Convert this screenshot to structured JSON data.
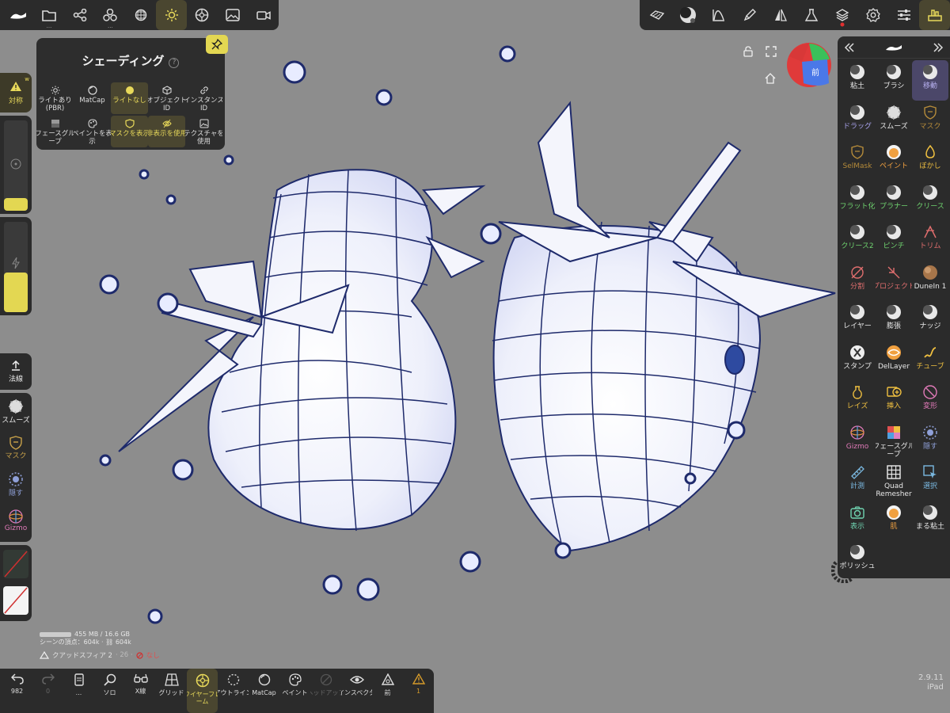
{
  "top_toolbar_left": {
    "items": [
      {
        "name": "logo",
        "dots": ""
      },
      {
        "name": "files",
        "dots": "..."
      },
      {
        "name": "scene",
        "dots": ""
      },
      {
        "name": "multires",
        "dots": "..."
      },
      {
        "name": "topology",
        "dots": ""
      },
      {
        "name": "shading",
        "dots": "",
        "active": true
      },
      {
        "name": "wireframe",
        "dots": ""
      },
      {
        "name": "image",
        "dots": ""
      },
      {
        "name": "camera",
        "dots": ""
      }
    ]
  },
  "top_toolbar_right": {
    "items": [
      "stroke",
      "matcap",
      "curve",
      "pen",
      "symmetry",
      "flask",
      "layers",
      "settings",
      "sliders",
      "tools"
    ]
  },
  "shading_popup": {
    "title": "シェーディング",
    "help": "?",
    "row1": [
      {
        "label": "ライトあり\n(PBR)"
      },
      {
        "label": "MatCap"
      },
      {
        "label": "ライトなし",
        "active": true
      },
      {
        "label": "オブジェクト\nID"
      },
      {
        "label": "インスタンス\nID"
      }
    ],
    "row2": [
      {
        "label": "フェースグル\nープ"
      },
      {
        "label": "ペイントを表\n示"
      },
      {
        "label": "マスクを表示",
        "active": true
      },
      {
        "label": "非表示を使用",
        "active": true
      },
      {
        "label": "テクスチャを\n使用"
      }
    ]
  },
  "left_panel": {
    "symmetry_label": "対称",
    "symmetry_tag": "w",
    "normal_label": "法線",
    "tools": [
      {
        "label": "スムーズ",
        "color": "#e8e8e8"
      },
      {
        "label": "マスク",
        "color": "#c9a24a"
      },
      {
        "label": "隠す",
        "color": "#8fa0d8"
      },
      {
        "label": "Gizmo",
        "color": "#e07ab8"
      }
    ],
    "slider_upper_fill": 0.15,
    "slider_lower_fill": 0.42
  },
  "right_panel": {
    "tools": [
      {
        "label": "粘土",
        "color": "#e8e8e8",
        "icon": "ball"
      },
      {
        "label": "ブラシ",
        "color": "#e8e8e8",
        "icon": "ball"
      },
      {
        "label": "移動",
        "color": "#b7b0f0",
        "icon": "ball",
        "active": true
      },
      {
        "label": "ドラッグ",
        "color": "#a9a3ee",
        "icon": "ball"
      },
      {
        "label": "スムーズ",
        "color": "#e8e8e8",
        "icon": "spiky"
      },
      {
        "label": "マスク",
        "color": "#b58b3a",
        "icon": "shield"
      },
      {
        "label": "SelMask",
        "color": "#b58b3a",
        "icon": "shield"
      },
      {
        "label": "ペイント",
        "color": "#f0a040",
        "icon": "orange"
      },
      {
        "label": "ぼかし",
        "color": "#f0c040",
        "icon": "drop"
      },
      {
        "label": "フラット化",
        "color": "#6fd36f",
        "icon": "ball"
      },
      {
        "label": "プラナー",
        "color": "#6fd36f",
        "icon": "ball"
      },
      {
        "label": "クリース",
        "color": "#6fd36f",
        "icon": "ball"
      },
      {
        "label": "クリース2",
        "color": "#6fd36f",
        "icon": "ball"
      },
      {
        "label": "ピンチ",
        "color": "#6fd36f",
        "icon": "ball"
      },
      {
        "label": "トリム",
        "color": "#e06e6e",
        "icon": "trim"
      },
      {
        "label": "分割",
        "color": "#e06e6e",
        "icon": "split"
      },
      {
        "label": "プロジェクト",
        "color": "#e06e6e",
        "icon": "project"
      },
      {
        "label": "DuneIn 1",
        "color": "#e8e8e8",
        "icon": "dune"
      },
      {
        "label": "レイヤー",
        "color": "#e8e8e8",
        "icon": "ball"
      },
      {
        "label": "膨張",
        "color": "#e8e8e8",
        "icon": "ball"
      },
      {
        "label": "ナッジ",
        "color": "#e8e8e8",
        "icon": "ball"
      },
      {
        "label": "スタンプ",
        "color": "#e8e8e8",
        "icon": "stamp"
      },
      {
        "label": "DelLayer",
        "color": "#e8e8e8",
        "icon": "dellayer"
      },
      {
        "label": "チューブ",
        "color": "#f0c040",
        "icon": "tube"
      },
      {
        "label": "レイズ",
        "color": "#f0c040",
        "icon": "lathe"
      },
      {
        "label": "挿入",
        "color": "#f0c040",
        "icon": "insert"
      },
      {
        "label": "変形",
        "color": "#e07ab8",
        "icon": "transform"
      },
      {
        "label": "Gizmo",
        "color": "#e07ab8",
        "icon": "gizmo"
      },
      {
        "label": "フェースグル\nープ",
        "color": "#e8e8e8",
        "icon": "facegroup"
      },
      {
        "label": "隠す",
        "color": "#8fa0d8",
        "icon": "hide"
      },
      {
        "label": "計測",
        "color": "#7ab8e0",
        "icon": "measure"
      },
      {
        "label": "Quad\nRemesher",
        "color": "#e8e8e8",
        "icon": "quad"
      },
      {
        "label": "選択",
        "color": "#7ab8e0",
        "icon": "select"
      },
      {
        "label": "表示",
        "color": "#6fd3b0",
        "icon": "view"
      },
      {
        "label": "肌",
        "color": "#f0a040",
        "icon": "orange"
      },
      {
        "label": "まる粘土",
        "color": "#e8e8e8",
        "icon": "ball"
      },
      {
        "label": "ポリッシュ",
        "color": "#e8e8e8",
        "icon": "ball"
      }
    ]
  },
  "gizmo": {
    "front_label": "前"
  },
  "stats": {
    "memory": "455 MB / 16.6 GB",
    "vertices": "シーンの頂点：604k · ⛓ 604k"
  },
  "mesh_info": {
    "name": "クアッドスフィア 2",
    "parts": "· 26 ·",
    "material": "なし"
  },
  "version": {
    "number": "2.9.11",
    "device": "iPad"
  },
  "bottom_bar": {
    "items": [
      {
        "name": "undo",
        "label": "982"
      },
      {
        "name": "redo",
        "label": "0",
        "dim": true
      },
      {
        "name": "device",
        "label": "..."
      },
      {
        "name": "solo",
        "label": "ソロ"
      },
      {
        "name": "xray",
        "label": "X線"
      },
      {
        "name": "grid",
        "label": "グリッド"
      },
      {
        "name": "wireframe",
        "label": "ワイヤーフレ\nーム",
        "active": true
      },
      {
        "name": "outline",
        "label": "アウトライン"
      },
      {
        "name": "matcap",
        "label": "MatCap"
      },
      {
        "name": "paint",
        "label": "ペイント"
      },
      {
        "name": "hidden",
        "label": "ヘッドアップ",
        "dim": true
      },
      {
        "name": "inspector",
        "label": "インスペクタ"
      },
      {
        "name": "front",
        "label": "前"
      },
      {
        "name": "warning",
        "label": "1",
        "warn": true
      }
    ]
  }
}
